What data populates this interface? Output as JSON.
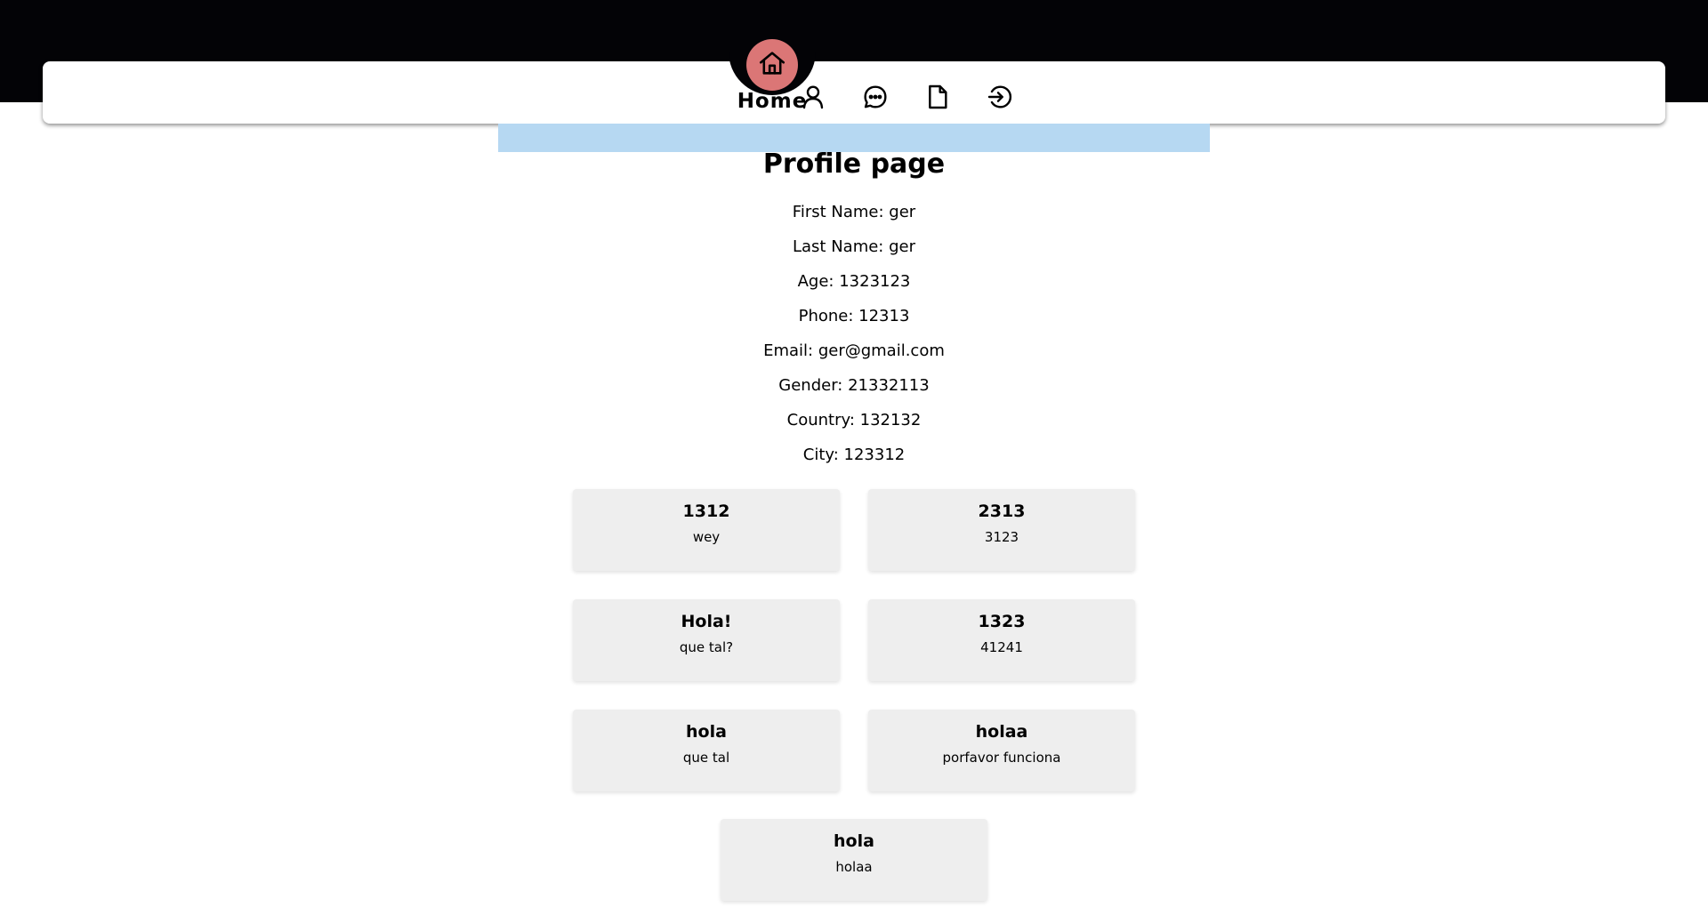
{
  "nav": {
    "active_label": "Home",
    "items": [
      {
        "icon": "home-icon",
        "label": "Home"
      },
      {
        "icon": "user-icon",
        "label": ""
      },
      {
        "icon": "chat-icon",
        "label": ""
      },
      {
        "icon": "document-icon",
        "label": ""
      },
      {
        "icon": "logout-icon",
        "label": ""
      }
    ],
    "colors": {
      "active_circle": "#db7676",
      "band": "#030306"
    }
  },
  "profile": {
    "title": "Profile page",
    "fields": [
      "First Name: ger",
      "Last Name: ger",
      "Age: 1323123",
      "Phone: 12313",
      "Email: ger@gmail.com",
      "Gender: 21332113",
      "Country: 132132",
      "City: 123312"
    ]
  },
  "cards": [
    {
      "title": "1312",
      "body": "wey"
    },
    {
      "title": "2313",
      "body": "3123"
    },
    {
      "title": "Hola!",
      "body": "que tal?"
    },
    {
      "title": "1323",
      "body": "41241"
    },
    {
      "title": "hola",
      "body": "que tal"
    },
    {
      "title": "holaa",
      "body": "porfavor funciona"
    },
    {
      "title": "hola",
      "body": "holaa"
    }
  ]
}
